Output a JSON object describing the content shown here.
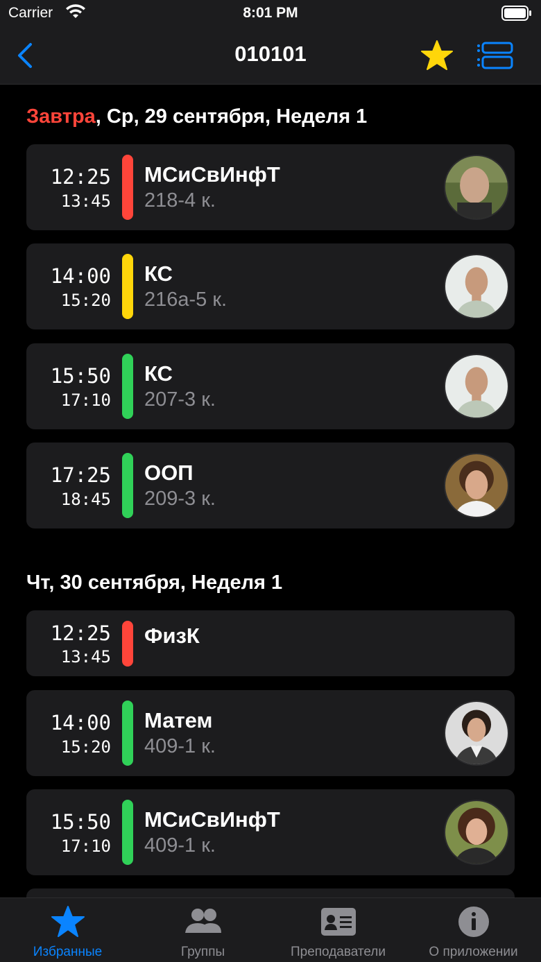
{
  "status_bar": {
    "carrier": "Carrier",
    "time": "8:01 PM"
  },
  "nav": {
    "title": "010101",
    "favorite_icon": "star-icon",
    "view_icon": "list-icon",
    "back_icon": "chevron-left-icon"
  },
  "colors": {
    "accent": "#0a84ff",
    "star": "#ffd60a",
    "red": "#ff453a",
    "yellow": "#ffd60a",
    "green": "#30d158"
  },
  "days": [
    {
      "prefix": "Завтра",
      "header": ", Ср, 29 сентября, Неделя 1",
      "lessons": [
        {
          "start": "12:25",
          "end": "13:45",
          "subject": "МСиСвИнфТ",
          "room": "218-4 к.",
          "bar": "red"
        },
        {
          "start": "14:00",
          "end": "15:20",
          "subject": "КС",
          "room": "216а-5 к.",
          "bar": "yellow"
        },
        {
          "start": "15:50",
          "end": "17:10",
          "subject": "КС",
          "room": "207-3 к.",
          "bar": "green"
        },
        {
          "start": "17:25",
          "end": "18:45",
          "subject": "ООП",
          "room": "209-3 к.",
          "bar": "green"
        }
      ]
    },
    {
      "prefix": "",
      "header": "Чт, 30 сентября, Неделя 1",
      "lessons": [
        {
          "start": "12:25",
          "end": "13:45",
          "subject": "ФизК",
          "room": "",
          "bar": "red"
        },
        {
          "start": "14:00",
          "end": "15:20",
          "subject": "Матем",
          "room": "409-1 к.",
          "bar": "green"
        },
        {
          "start": "15:50",
          "end": "17:10",
          "subject": "МСиСвИнфТ",
          "room": "409-1 к.",
          "bar": "green"
        }
      ]
    }
  ],
  "tabs": [
    {
      "label": "Избранные",
      "icon": "star-icon",
      "active": true
    },
    {
      "label": "Группы",
      "icon": "people-icon",
      "active": false
    },
    {
      "label": "Преподаватели",
      "icon": "contact-card-icon",
      "active": false
    },
    {
      "label": "О приложении",
      "icon": "info-icon",
      "active": false
    }
  ]
}
